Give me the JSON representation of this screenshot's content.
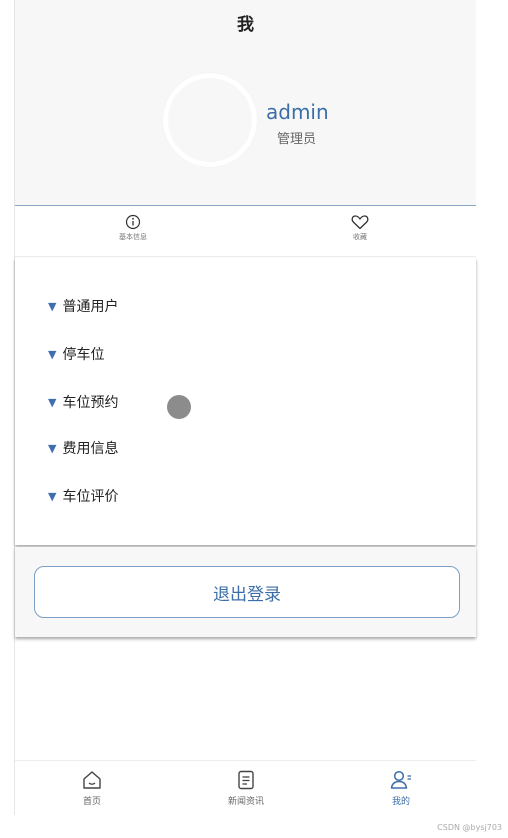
{
  "header": {
    "title": "我",
    "username": "admin",
    "role": "管理员"
  },
  "info_tabs": [
    {
      "label": "基本信息",
      "icon": "info-icon"
    },
    {
      "label": "收藏",
      "icon": "heart-icon"
    }
  ],
  "menu": {
    "items": [
      {
        "label": "普通用户"
      },
      {
        "label": "停车位"
      },
      {
        "label": "车位预约"
      },
      {
        "label": "费用信息"
      },
      {
        "label": "车位评价"
      }
    ]
  },
  "logout": {
    "label": "退出登录"
  },
  "bottom_nav": {
    "items": [
      {
        "label": "首页",
        "icon": "home-icon",
        "active": false
      },
      {
        "label": "新闻资讯",
        "icon": "news-icon",
        "active": false
      },
      {
        "label": "我的",
        "icon": "user-icon",
        "active": true
      }
    ]
  },
  "watermark": "CSDN @bysj703",
  "colors": {
    "accent": "#3b6ea8",
    "header_bg": "#f7f7f7",
    "triangle": "#3d6fb0"
  }
}
